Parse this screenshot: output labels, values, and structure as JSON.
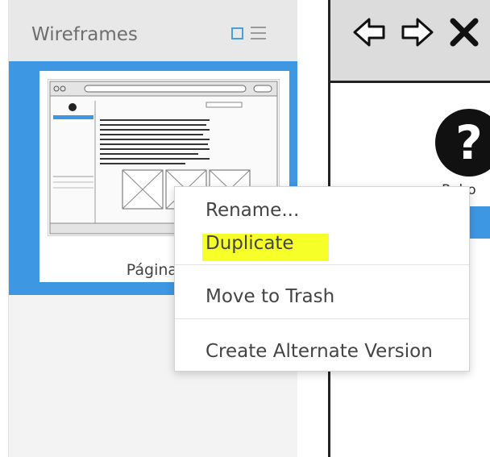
{
  "panel": {
    "title": "Wireframes",
    "page_name": "Página pri"
  },
  "canvas": {
    "partial_label": "Rebo"
  },
  "context_menu": {
    "items": [
      "Rename...",
      "Duplicate",
      "Move to Trash",
      "Create Alternate Version"
    ],
    "highlighted_item": "Duplicate"
  },
  "icons": {
    "view_grid": "grid-view-icon",
    "view_list": "list-view-icon",
    "back": "arrow-left-icon",
    "forward": "arrow-right-icon",
    "close": "close-icon",
    "help": "help-icon"
  },
  "colors": {
    "selection": "#3d97e2",
    "highlight": "#f6ff27",
    "accent_icon": "#4a9ee0"
  }
}
